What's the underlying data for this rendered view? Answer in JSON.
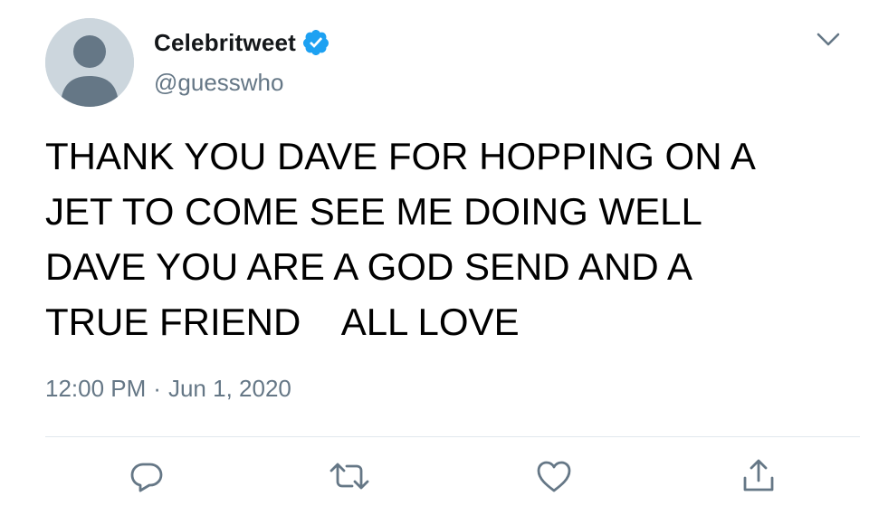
{
  "tweet": {
    "display_name": "Celebritweet",
    "handle": "@guesswho",
    "text": "THANK YOU DAVE FOR HOPPING ON A\nJET TO COME SEE ME DOING WELL\nDAVE YOU ARE A GOD SEND AND A\nTRUE FRIEND    ALL LOVE",
    "time": "12:00 PM",
    "separator": "·",
    "date": "Jun 1, 2020",
    "verified": true
  },
  "icons": {
    "avatar": "default-avatar-icon",
    "verified": "verified-badge-icon",
    "menu": "chevron-down-icon",
    "reply": "reply-icon",
    "retweet": "retweet-icon",
    "like": "heart-icon",
    "share": "share-icon"
  },
  "colors": {
    "verified_blue": "#1da1f2",
    "secondary_text": "#657786",
    "avatar_bg": "#ccd6dd",
    "avatar_fg": "#657786",
    "divider": "#e1e8ed"
  }
}
